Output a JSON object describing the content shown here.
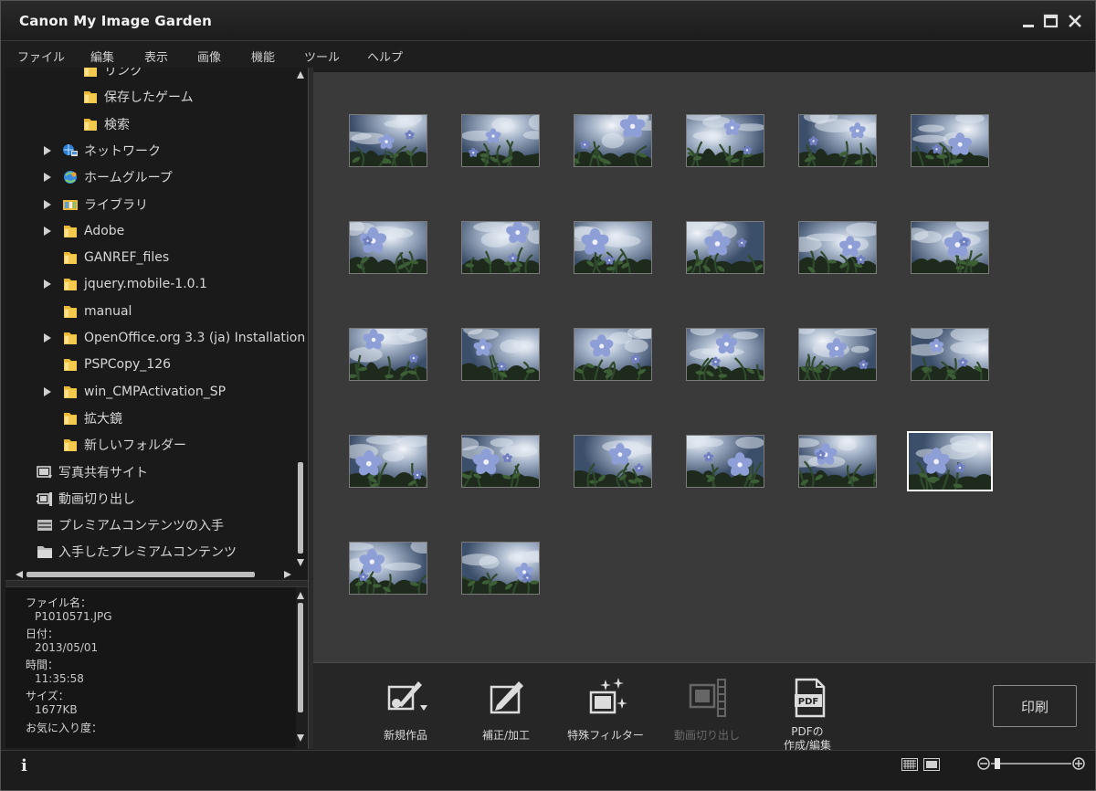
{
  "window": {
    "title": "Canon My Image Garden"
  },
  "menu": [
    "ファイル",
    "編集",
    "表示",
    "画像",
    "機能",
    "ツール",
    "ヘルプ"
  ],
  "tree": [
    {
      "label": "リンク",
      "icon": "folder-icon",
      "arrow": false,
      "indent": 2
    },
    {
      "label": "保存したゲーム",
      "icon": "folder-icon",
      "arrow": false,
      "indent": 2
    },
    {
      "label": "検索",
      "icon": "folder-icon",
      "arrow": false,
      "indent": 2
    },
    {
      "label": "ネットワーク",
      "icon": "network-icon",
      "arrow": true,
      "indent": 1
    },
    {
      "label": "ホームグループ",
      "icon": "homegroup-icon",
      "arrow": true,
      "indent": 1
    },
    {
      "label": "ライブラリ",
      "icon": "library-icon",
      "arrow": true,
      "indent": 1
    },
    {
      "label": "Adobe",
      "icon": "folder-icon",
      "arrow": true,
      "indent": 1
    },
    {
      "label": "GANREF_files",
      "icon": "folder-icon",
      "arrow": false,
      "indent": 1
    },
    {
      "label": "jquery.mobile-1.0.1",
      "icon": "folder-icon",
      "arrow": true,
      "indent": 1
    },
    {
      "label": "manual",
      "icon": "folder-icon",
      "arrow": false,
      "indent": 1
    },
    {
      "label": "OpenOffice.org 3.3 (ja) Installation Files",
      "icon": "folder-icon",
      "arrow": true,
      "indent": 1
    },
    {
      "label": "PSPCopy_126",
      "icon": "folder-icon",
      "arrow": false,
      "indent": 1
    },
    {
      "label": "win_CMPActivation_SP",
      "icon": "folder-icon",
      "arrow": true,
      "indent": 1
    },
    {
      "label": "拡大鏡",
      "icon": "folder-icon",
      "arrow": false,
      "indent": 1
    },
    {
      "label": "新しいフォルダー",
      "icon": "folder-icon",
      "arrow": false,
      "indent": 1
    },
    {
      "label": "写真共有サイト",
      "icon": "photo-share-icon",
      "arrow": false,
      "indent": 0
    },
    {
      "label": "動画切り出し",
      "icon": "video-frame-icon",
      "arrow": false,
      "indent": 0
    },
    {
      "label": "プレミアムコンテンツの入手",
      "icon": "premium-icon",
      "arrow": false,
      "indent": 0
    },
    {
      "label": "入手したプレミアムコンテンツ",
      "icon": "folder-dark-icon",
      "arrow": false,
      "indent": 0
    }
  ],
  "info": {
    "filename_label": "ファイル名：",
    "filename": "P1010571.JPG",
    "date_label": "日付：",
    "date": "2013/05/01",
    "time_label": "時間：",
    "time": "11:35:58",
    "size_label": "サイズ：",
    "size": "1677KB",
    "rating_label": "お気に入り度："
  },
  "thumbnails": {
    "count": 26,
    "columns": 6,
    "selected_index": 23
  },
  "toolbar": {
    "tools": [
      {
        "label": "新規作品",
        "icon": "new-work-icon",
        "enabled": true
      },
      {
        "label": "補正/加工",
        "icon": "correct-edit-icon",
        "enabled": true
      },
      {
        "label": "特殊フィルター",
        "icon": "special-filter-icon",
        "enabled": true
      },
      {
        "label": "動画切り出し",
        "icon": "video-frame-capture-icon",
        "enabled": false
      },
      {
        "label": "PDFの作成/編集",
        "line1": "PDFの",
        "line2": "作成/編集",
        "icon": "pdf-icon",
        "enabled": true
      }
    ],
    "print_label": "印刷"
  },
  "colors": {
    "background": "#1e1e1e",
    "grid_background": "#3a3a3a",
    "text": "#d8d8d8",
    "folder": "#e8b838"
  }
}
